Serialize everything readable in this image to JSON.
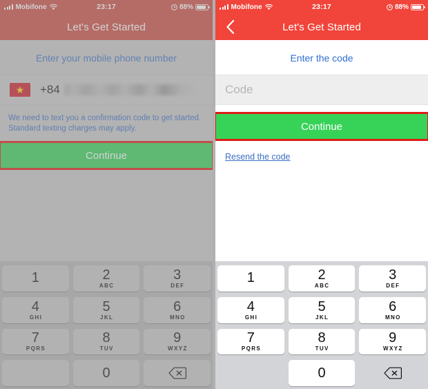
{
  "theme": {
    "nav_red": "#f1443a",
    "accent_blue": "#2f6fd0",
    "cta_green": "#37d359",
    "annotation_red": "#e01b17",
    "flag_red": "#cc1f2b",
    "flag_star": "#ffdd22"
  },
  "status_bar": {
    "carrier": "Mobifone",
    "signal_icon": "signal-bars-icon",
    "wifi_icon": "wifi-icon",
    "time": "23:17",
    "alarm_icon": "alarm-clock-icon",
    "battery_percent": "88%",
    "battery_icon": "battery-icon",
    "battery_level": 88
  },
  "left_screen": {
    "nav": {
      "title": "Let's Get Started",
      "has_back": false
    },
    "heading": "Enter your mobile phone number",
    "phone_field": {
      "flag_icon": "vietnam-flag-icon",
      "country_code": "+84",
      "number_value": "",
      "number_redacted": true
    },
    "disclaimer": "We need to text you a confirmation code to get started. Standard texting charges may apply.",
    "continue_label": "Continue",
    "continue_highlighted": true
  },
  "right_screen": {
    "nav": {
      "title": "Let's Get Started",
      "has_back": true,
      "back_icon": "chevron-left-icon"
    },
    "heading": "Enter the code",
    "code_field": {
      "value": "",
      "placeholder": "Code"
    },
    "continue_label": "Continue",
    "continue_highlighted": true,
    "resend_label": "Resend the code"
  },
  "keypad": {
    "delete_icon": "backspace-icon",
    "rows": [
      [
        {
          "num": "1",
          "sub": ""
        },
        {
          "num": "2",
          "sub": "ABC"
        },
        {
          "num": "3",
          "sub": "DEF"
        }
      ],
      [
        {
          "num": "4",
          "sub": "GHI"
        },
        {
          "num": "5",
          "sub": "JKL"
        },
        {
          "num": "6",
          "sub": "MNO"
        }
      ],
      [
        {
          "num": "7",
          "sub": "PQRS"
        },
        {
          "num": "8",
          "sub": "TUV"
        },
        {
          "num": "9",
          "sub": "WXYZ"
        }
      ],
      [
        {
          "num": "",
          "sub": ""
        },
        {
          "num": "0",
          "sub": ""
        },
        {
          "num": "",
          "sub": ""
        }
      ]
    ]
  }
}
